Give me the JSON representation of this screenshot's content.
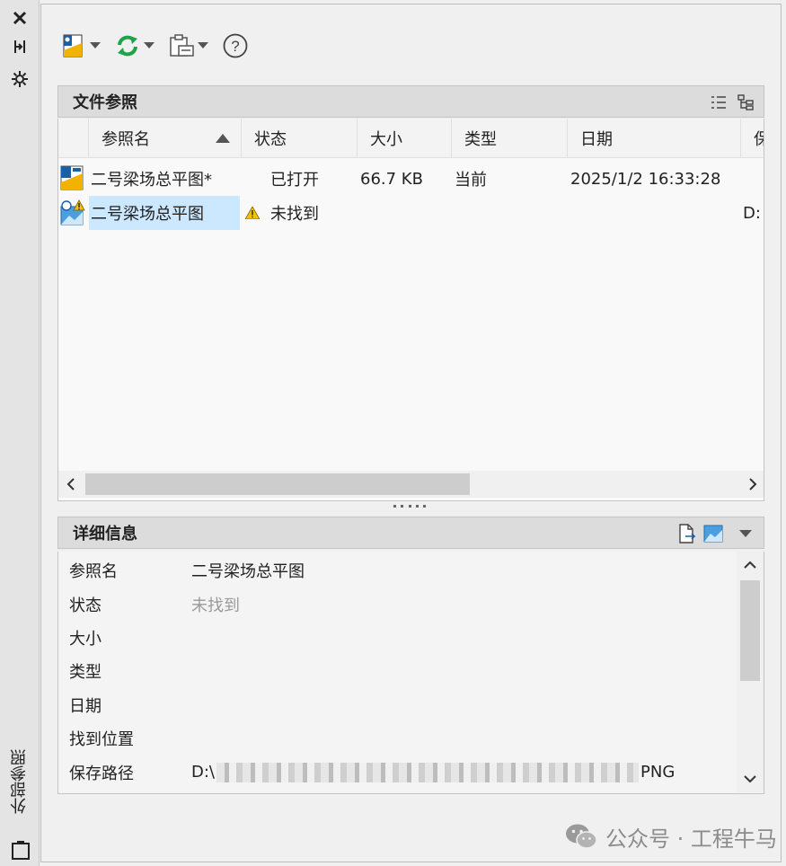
{
  "side_panel": {
    "title": "外部参照"
  },
  "toolbar": {
    "attach_icon": "attach-dwg-icon",
    "refresh_icon": "refresh-icon",
    "change_path_icon": "change-path-icon",
    "help_icon": "help-icon",
    "help_glyph": "?"
  },
  "file_refs": {
    "title": "文件参照",
    "columns": [
      "参照名",
      "状态",
      "大小",
      "类型",
      "日期",
      "保"
    ],
    "rows": [
      {
        "name": "二号梁场总平图*",
        "status": "已打开",
        "size": "66.7 KB",
        "type": "当前",
        "date": "2025/1/2 16:33:28",
        "path": "",
        "icon": "dwg-file-icon",
        "warning": false
      },
      {
        "name": "二号梁场总平图",
        "status": "未找到",
        "size": "",
        "type": "",
        "date": "",
        "path": "D:",
        "icon": "image-file-warning-icon",
        "warning": true
      }
    ],
    "selected_row": 1
  },
  "details": {
    "title": "详细信息",
    "fields": [
      {
        "label": "参照名",
        "value": "二号梁场总平图",
        "gray": false
      },
      {
        "label": "状态",
        "value": "未找到",
        "gray": true
      },
      {
        "label": "大小",
        "value": "",
        "gray": false
      },
      {
        "label": "类型",
        "value": "",
        "gray": false
      },
      {
        "label": "日期",
        "value": "",
        "gray": false
      },
      {
        "label": "找到位置",
        "value": "",
        "gray": false
      },
      {
        "label": "保存路径",
        "value_prefix": "D:\\",
        "value_suffix": "PNG",
        "gray": false
      }
    ]
  },
  "watermark": {
    "text": "公众号 · 工程牛马"
  },
  "colors": {
    "selection": "#cce8ff",
    "refresh_green": "#1fa34a",
    "warning_yellow": "#f2c200",
    "dwg_blue": "#1c5fa8"
  }
}
